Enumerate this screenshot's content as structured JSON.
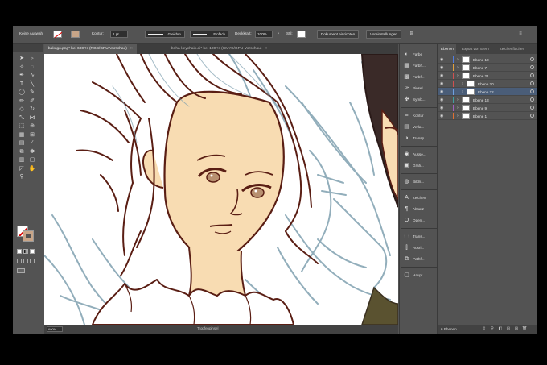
{
  "control_bar": {
    "selection_label": "Keine Auswahl",
    "stroke_label": "Kontur:",
    "stroke_weight": "1 pt",
    "profile_label": "Gleichm.",
    "brush_label": "Einfach",
    "opacity_label": "Deckkraft:",
    "opacity_value": "100%",
    "style_label": "Stil:",
    "doc_setup_button": "Dokument einrichten",
    "preferences_button": "Voreinstellungen"
  },
  "tabs": [
    {
      "label": "bakugo.png* bei 600 % (RGB/GPU-Vorschau)",
      "close": "×"
    },
    {
      "label": "bnha-keychain.ai* bei 100 % (CMYK/GPU-Vorschau)",
      "close": "×"
    }
  ],
  "status_bar": {
    "zoom": "600%",
    "tool_name": "Tropfenpinsel"
  },
  "dock": [
    {
      "icon": "color-icon",
      "label": "Farbe"
    },
    {
      "icon": "color-guide-icon",
      "label": "Farbh..."
    },
    {
      "icon": "swatches-icon",
      "label": "Farbf..."
    },
    {
      "icon": "brushes-icon",
      "label": "Pinsel"
    },
    {
      "icon": "symbols-icon",
      "label": "Symb..."
    },
    {
      "icon": "stroke-icon",
      "label": "Kontur"
    },
    {
      "icon": "gradient-icon",
      "label": "Verla..."
    },
    {
      "icon": "transparency-icon",
      "label": "Transp..."
    },
    {
      "icon": "appearance-icon",
      "label": "Ausse..."
    },
    {
      "icon": "graphic-styles-icon",
      "label": "Grafi..."
    },
    {
      "icon": "image-trace-icon",
      "label": "Bildn..."
    },
    {
      "icon": "character-icon",
      "label": "Zeichen"
    },
    {
      "icon": "paragraph-icon",
      "label": "Absatz"
    },
    {
      "icon": "opentype-icon",
      "label": "Open..."
    },
    {
      "icon": "transform-icon",
      "label": "Trans..."
    },
    {
      "icon": "align-icon",
      "label": "Ausri..."
    },
    {
      "icon": "pathfinder-icon",
      "label": "Pathf..."
    },
    {
      "icon": "artboards-icon",
      "label": "Haupt..."
    }
  ],
  "layers_panel": {
    "tabs": [
      "Ebenen",
      "Export von Elem",
      "Zeichenflächen"
    ],
    "layers": [
      {
        "name": "Ebene 10",
        "color": "#4f7ce0",
        "selected": false,
        "indent": 0
      },
      {
        "name": "Ebene 7",
        "color": "#e0a040",
        "selected": false,
        "indent": 0
      },
      {
        "name": "Ebene 21",
        "color": "#d05050",
        "selected": false,
        "indent": 0
      },
      {
        "name": "Ebene 20",
        "color": "#d05050",
        "selected": false,
        "indent": 1
      },
      {
        "name": "Ebene 22",
        "color": "#6fa0e0",
        "selected": true,
        "indent": 1
      },
      {
        "name": "Ebene 13",
        "color": "#40a0a0",
        "selected": false,
        "indent": 0
      },
      {
        "name": "Ebene 9",
        "color": "#a060c0",
        "selected": false,
        "indent": 0
      },
      {
        "name": "Ebene 1",
        "color": "#e07030",
        "selected": false,
        "indent": 0
      }
    ],
    "footer_count": "6 Ebenen"
  },
  "colors": {
    "ui_bg": "#535353",
    "panel_dark": "#424242",
    "fill_color": "#ffffff",
    "stroke_color": "#c8a588",
    "skin": "#f8dcb2",
    "outline": "#5a1e14",
    "sketch": "#7fa0b0",
    "selection_blue": "#4a5d78"
  }
}
